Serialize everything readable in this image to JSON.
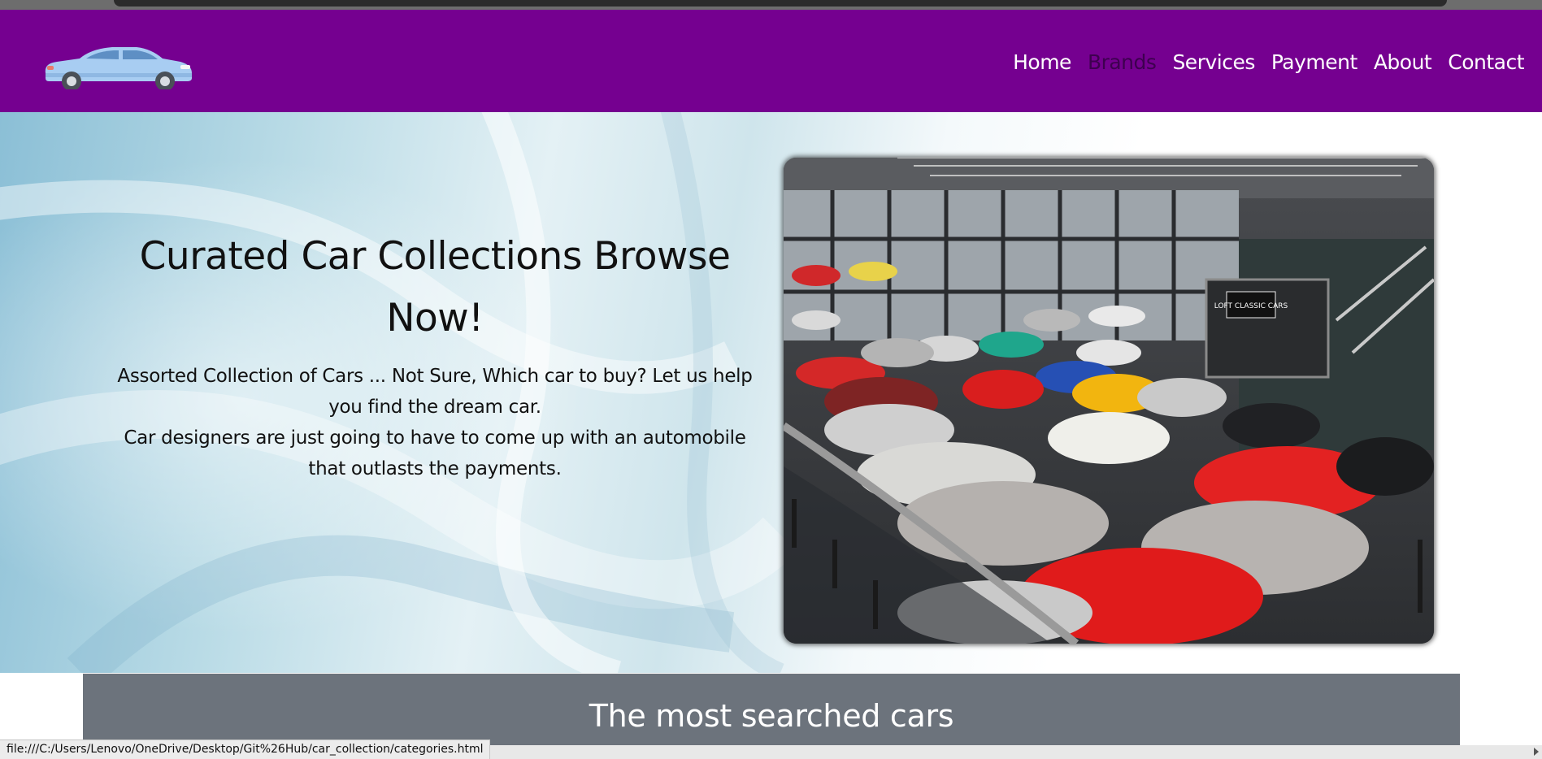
{
  "nav": {
    "links": [
      {
        "label": "Home",
        "active": false
      },
      {
        "label": "Brands",
        "active": true
      },
      {
        "label": "Services",
        "active": false
      },
      {
        "label": "Payment",
        "active": false
      },
      {
        "label": "About",
        "active": false
      },
      {
        "label": "Contact",
        "active": false
      }
    ]
  },
  "hero": {
    "title": "Curated Car Collections Browse Now!",
    "line1": "Assorted Collection of Cars ... Not Sure, Which car to buy? Let us help you find the dream car.",
    "line2": "Car designers are just going to have to come up with an automobile that outlasts the payments.",
    "sign_text": "LOFT CLASSIC CARS"
  },
  "section": {
    "title": "The most searched cars"
  },
  "status_bar": {
    "url": "file:///C:/Users/Lenovo/OneDrive/Desktop/Git%26Hub/car_collection/categories.html"
  },
  "colors": {
    "navbar": "#750090",
    "nav_active": "#3e0050",
    "section_bg": "#6c737c"
  }
}
